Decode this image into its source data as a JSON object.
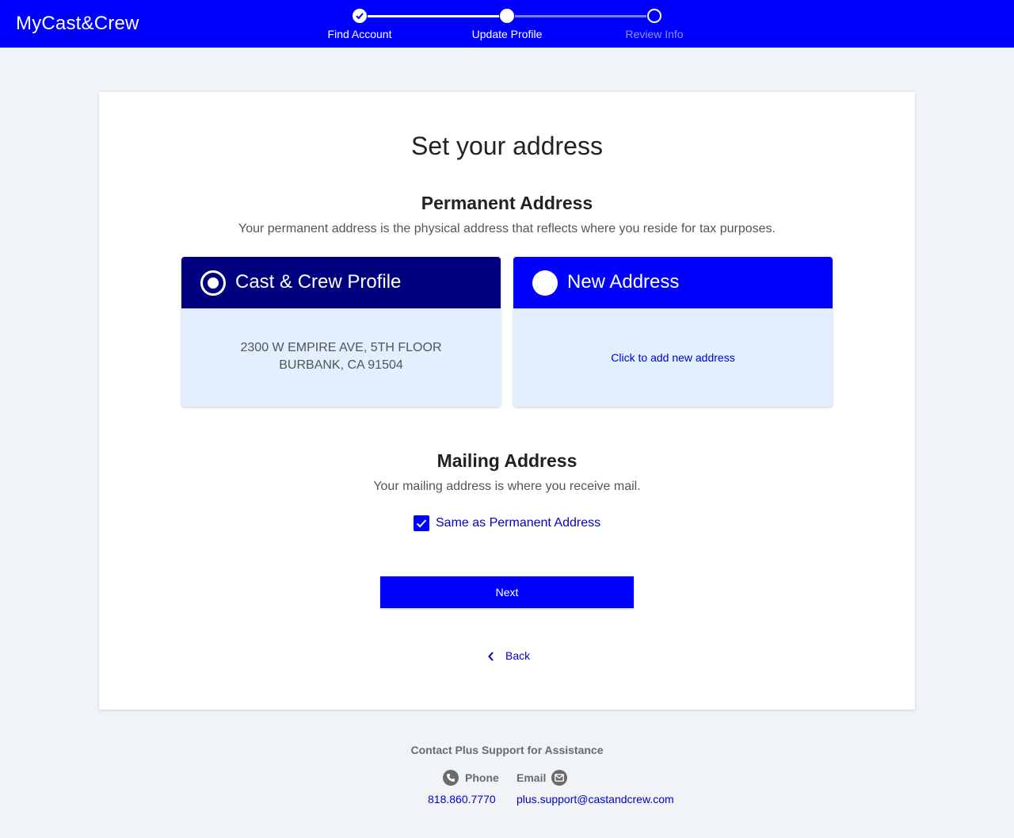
{
  "header": {
    "logo": "MyCast&Crew",
    "steps": [
      {
        "label": "Find Account",
        "state": "complete"
      },
      {
        "label": "Update Profile",
        "state": "current"
      },
      {
        "label": "Review Info",
        "state": "upcoming"
      }
    ]
  },
  "main": {
    "title": "Set your address",
    "permanent": {
      "heading": "Permanent Address",
      "description": "Your permanent address is the physical address that reflects where you reside for tax purposes.",
      "options": {
        "profile": {
          "label": "Cast & Crew Profile",
          "selected": true,
          "address_line1": "2300 W EMPIRE AVE, 5TH FLOOR",
          "address_line2": "BURBANK, CA 91504"
        },
        "new": {
          "label": "New Address",
          "selected": false,
          "action": "Click to add new address"
        }
      }
    },
    "mailing": {
      "heading": "Mailing Address",
      "description": "Your mailing address is where you receive mail.",
      "same_as_permanent_label": "Same as Permanent Address",
      "same_as_permanent_checked": true
    },
    "next_label": "Next",
    "back_label": "Back"
  },
  "footer": {
    "title": "Contact Plus Support for Assistance",
    "phone_label": "Phone",
    "phone_number": "818.860.7770",
    "email_label": "Email",
    "email_address": "plus.support@castandcrew.com"
  },
  "colors": {
    "brand_blue": "#0000ff",
    "selected_navy": "#00007f",
    "option_body": "#e1efff",
    "link_blue": "#0000cc",
    "page_bg": "#f0f4f7"
  },
  "icons": {
    "step_complete": "check-icon",
    "back": "chevron-left-icon",
    "phone": "phone-icon",
    "email": "envelope-icon",
    "checkbox": "checkmark-icon"
  }
}
